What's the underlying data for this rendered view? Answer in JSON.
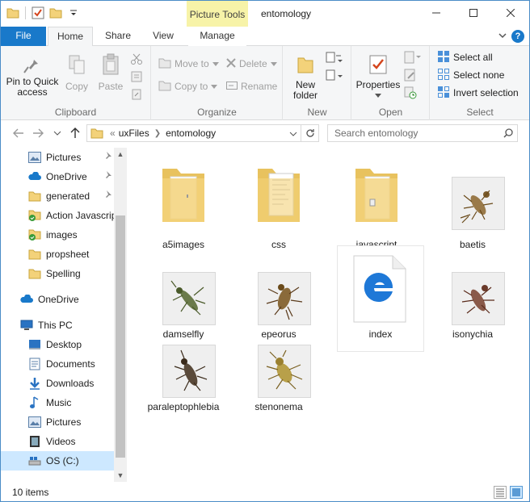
{
  "window": {
    "title": "entomology",
    "context_tab": "Picture Tools"
  },
  "tabs": [
    {
      "label": "File"
    },
    {
      "label": "Home"
    },
    {
      "label": "Share"
    },
    {
      "label": "View"
    },
    {
      "label": "Manage"
    }
  ],
  "ribbon": {
    "clipboard": {
      "label": "Clipboard",
      "pin": "Pin to Quick access",
      "pin_line1": "Pin to Quick",
      "pin_line2": "access",
      "copy": "Copy",
      "paste": "Paste"
    },
    "organize": {
      "label": "Organize",
      "move_to": "Move to",
      "copy_to": "Copy to",
      "delete": "Delete",
      "rename": "Rename"
    },
    "new": {
      "label": "New",
      "new_folder_line1": "New",
      "new_folder_line2": "folder"
    },
    "open": {
      "label": "Open",
      "properties": "Properties"
    },
    "select": {
      "label": "Select",
      "select_all": "Select all",
      "select_none": "Select none",
      "invert": "Invert selection"
    }
  },
  "address": {
    "overflow": "«",
    "crumbs": [
      "uxFiles",
      "entomology"
    ],
    "search_placeholder": "Search entomology"
  },
  "navpane": {
    "items": [
      {
        "label": "Pictures",
        "icon": "pictures-icon",
        "pinned": true
      },
      {
        "label": "OneDrive",
        "icon": "onedrive-icon",
        "pinned": true
      },
      {
        "label": "generated",
        "icon": "folder-icon",
        "pinned": true
      },
      {
        "label": "Action Javascript",
        "icon": "folder-check-icon",
        "pinned": false
      },
      {
        "label": "images",
        "icon": "folder-check-icon",
        "pinned": false
      },
      {
        "label": "propsheet",
        "icon": "folder-icon",
        "pinned": false
      },
      {
        "label": "Spelling",
        "icon": "folder-icon",
        "pinned": false
      },
      {
        "label": "OneDrive",
        "icon": "onedrive-icon",
        "pinned": false
      },
      {
        "label": "This PC",
        "icon": "pc-icon",
        "pinned": false
      },
      {
        "label": "Desktop",
        "icon": "desktop-icon",
        "pinned": false
      },
      {
        "label": "Documents",
        "icon": "documents-icon",
        "pinned": false
      },
      {
        "label": "Downloads",
        "icon": "downloads-icon",
        "pinned": false
      },
      {
        "label": "Music",
        "icon": "music-icon",
        "pinned": false
      },
      {
        "label": "Pictures",
        "icon": "pictures-icon",
        "pinned": false
      },
      {
        "label": "Videos",
        "icon": "videos-icon",
        "pinned": false
      },
      {
        "label": "OS (C:)",
        "icon": "drive-icon",
        "pinned": false
      }
    ]
  },
  "files": [
    {
      "name": "a5images",
      "kind": "folder"
    },
    {
      "name": "css",
      "kind": "folder"
    },
    {
      "name": "javascript",
      "kind": "folder"
    },
    {
      "name": "baetis",
      "kind": "image"
    },
    {
      "name": "damselfly",
      "kind": "image"
    },
    {
      "name": "epeorus",
      "kind": "image"
    },
    {
      "name": "index",
      "kind": "html"
    },
    {
      "name": "isonychia",
      "kind": "image"
    },
    {
      "name": "paraleptophlebia",
      "kind": "image"
    },
    {
      "name": "stenonema",
      "kind": "image"
    }
  ],
  "status": {
    "count": "10 items"
  },
  "colors": {
    "accent": "#1979ca",
    "context_tab": "#f7f3a8",
    "selection": "#cde8ff",
    "folder": "#f3d27a",
    "edge_blue": "#1e78d7"
  }
}
